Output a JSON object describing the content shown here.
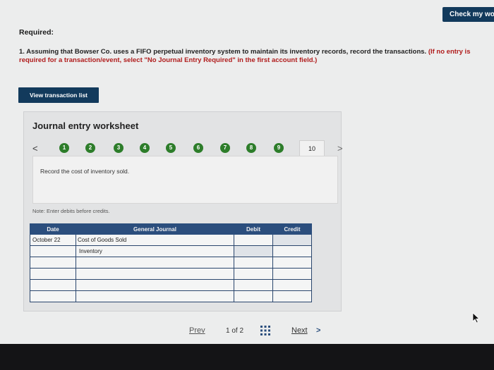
{
  "header": {
    "check_button": "Check my wo"
  },
  "question": {
    "required_label": "Required:",
    "instruction": "1. Assuming that Bowser Co. uses a FIFO perpetual inventory system to maintain its inventory records, record the transactions.",
    "instruction_note": "(If no entry is required for a transaction/event, select \"No Journal Entry Required\" in the first account field.)"
  },
  "view_transaction_button": "View transaction list",
  "worksheet": {
    "title": "Journal entry worksheet",
    "prev_arrow": "<",
    "next_arrow": ">",
    "steps": [
      "1",
      "2",
      "3",
      "4",
      "5",
      "6",
      "7",
      "8",
      "9"
    ],
    "current_step": "10",
    "description": "Record the cost of inventory sold.",
    "note": "Note: Enter debits before credits.",
    "table": {
      "headers": {
        "date": "Date",
        "account": "General Journal",
        "debit": "Debit",
        "credit": "Credit"
      },
      "rows": [
        {
          "date": "October 22",
          "account": "Cost of Goods Sold",
          "debit": "",
          "credit": ""
        },
        {
          "date": "",
          "account": "Inventory",
          "debit": "",
          "credit": ""
        },
        {
          "date": "",
          "account": "",
          "debit": "",
          "credit": ""
        },
        {
          "date": "",
          "account": "",
          "debit": "",
          "credit": ""
        },
        {
          "date": "",
          "account": "",
          "debit": "",
          "credit": ""
        },
        {
          "date": "",
          "account": "",
          "debit": "",
          "credit": ""
        }
      ]
    }
  },
  "pagination": {
    "prev": "Prev",
    "page": "1 of 2",
    "next": "Next",
    "next_arrow": ">"
  },
  "colors": {
    "accent": "#123a5c",
    "step_complete": "#2d7d2a",
    "table_header": "#2b4e7d"
  }
}
